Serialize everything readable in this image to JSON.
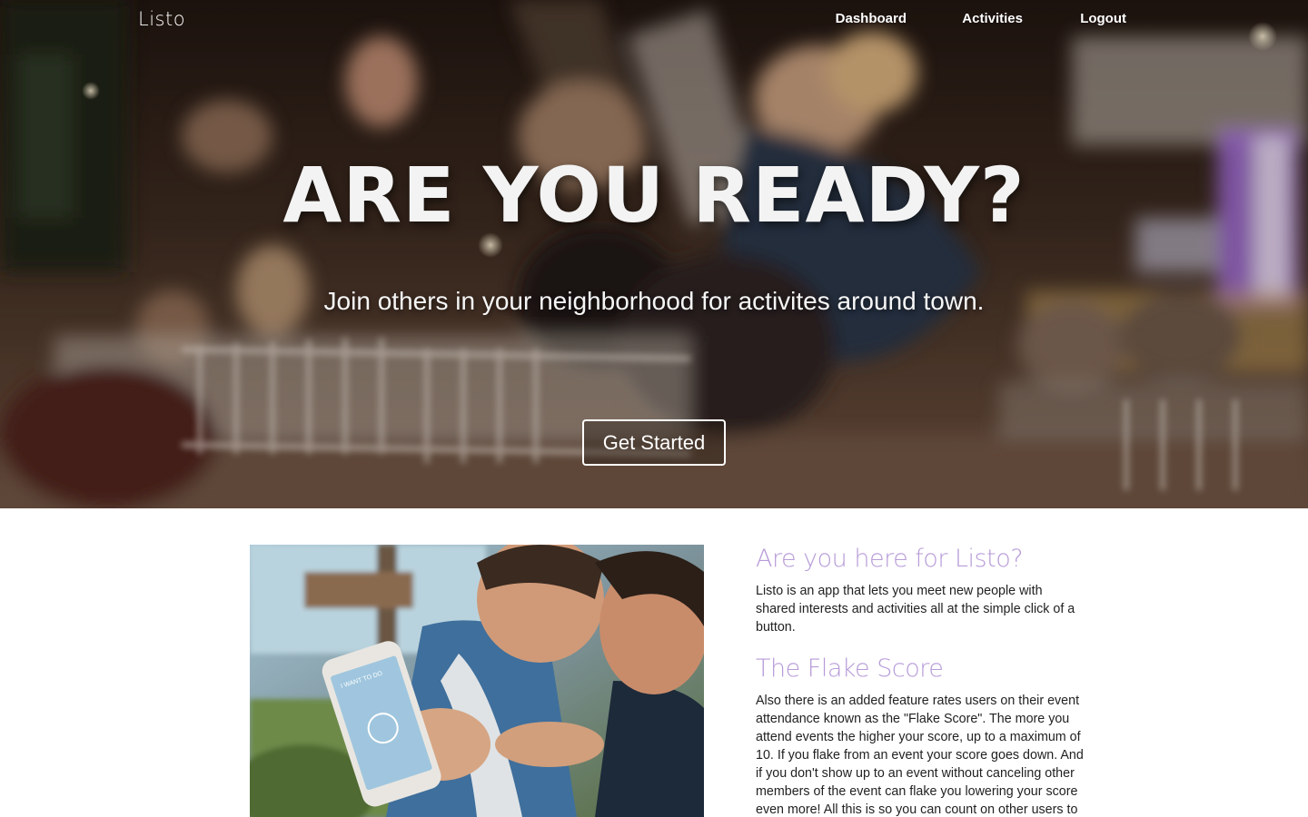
{
  "nav": {
    "logo": "Listo",
    "links": [
      "Dashboard",
      "Activities",
      "Logout"
    ]
  },
  "hero": {
    "title": "ARE YOU READY?",
    "subtitle": "Join others in your neighborhood for activites around town.",
    "cta_label": "Get Started"
  },
  "content": {
    "sections": [
      {
        "heading": "Are you here for Listo?",
        "body": "Listo is an app that lets you meet new people with shared interests and activities all at the simple click of a button."
      },
      {
        "heading": "The Flake Score",
        "body": "Also there is an added feature rates users on their event attendance known as the \"Flake Score\". The more you attend events the higher your score, up to a maximum of 10. If you flake from an event your score goes down. And if you don't show up to an event without canceling other members of the event can flake you lowering your score even more! All this is so you can count on other users to"
      }
    ],
    "photo_phone_screen_text": "I WANT TO DO"
  },
  "colors": {
    "accent_heading": "#b79bd8",
    "hero_text": "#f3f3f3",
    "body_text": "#222222"
  }
}
